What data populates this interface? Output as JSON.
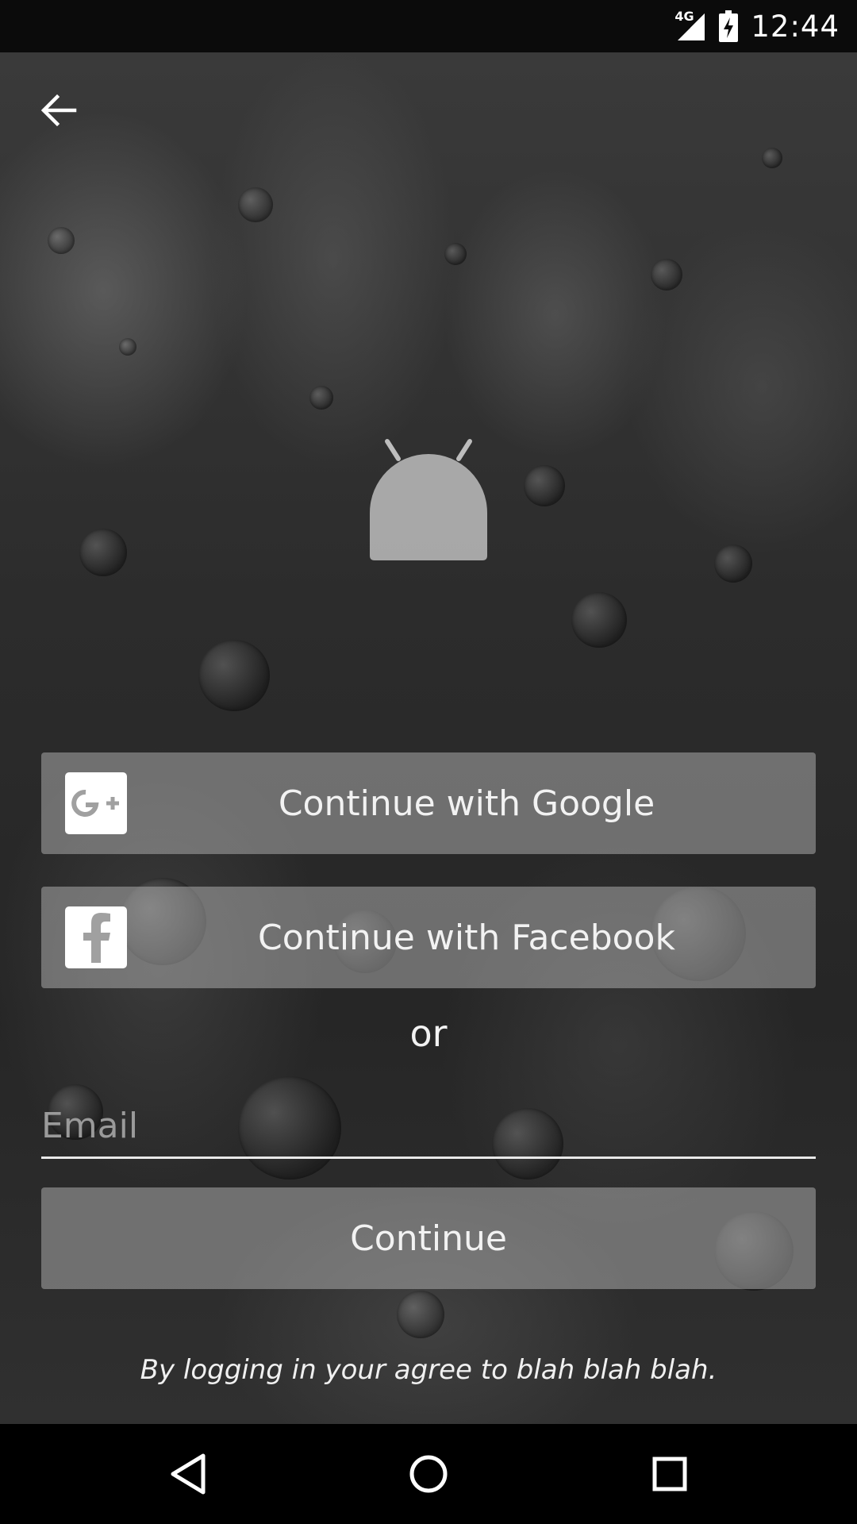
{
  "status_bar": {
    "network_label": "4G",
    "time": "12:44"
  },
  "logo": {
    "icon": "android-logo-icon"
  },
  "buttons": {
    "google": {
      "label": "Continue with Google",
      "icon": "google-plus-icon"
    },
    "facebook": {
      "label": "Continue with Facebook",
      "icon": "facebook-icon"
    },
    "continue": {
      "label": "Continue"
    }
  },
  "divider_text": "or",
  "email": {
    "placeholder": "Email",
    "value": ""
  },
  "terms_text": "By logging in your agree to blah blah blah.",
  "colors": {
    "button_bg": "#aaaaaa",
    "text": "#f2f2f2",
    "status_bar_bg": "#0b0b0b",
    "nav_bar_bg": "#000000"
  }
}
